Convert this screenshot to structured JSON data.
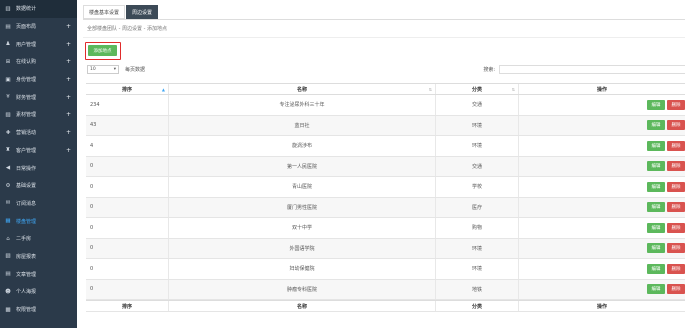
{
  "sidebar": {
    "items": [
      {
        "label": "数据统计",
        "icon": "bar-chart-icon",
        "expandable": false
      },
      {
        "label": "页面布局",
        "icon": "layout-icon",
        "expandable": true
      },
      {
        "label": "用户管理",
        "icon": "user-icon",
        "expandable": true
      },
      {
        "label": "在线认购",
        "icon": "cart-icon",
        "expandable": true
      },
      {
        "label": "身份管理",
        "icon": "id-card-icon",
        "expandable": true
      },
      {
        "label": "财务管理",
        "icon": "money-icon",
        "expandable": true
      },
      {
        "label": "素材管理",
        "icon": "image-icon",
        "expandable": true
      },
      {
        "label": "营销活动",
        "icon": "gift-icon",
        "expandable": true
      },
      {
        "label": "客户管理",
        "icon": "customer-icon",
        "expandable": true
      },
      {
        "label": "日常操作",
        "icon": "megaphone-icon",
        "expandable": false
      },
      {
        "label": "基础设置",
        "icon": "settings-icon",
        "expandable": false
      },
      {
        "label": "订阅消息",
        "icon": "message-icon",
        "expandable": false
      },
      {
        "label": "楼盘管理",
        "icon": "building-icon",
        "expandable": false
      },
      {
        "label": "二手房",
        "icon": "house-icon",
        "expandable": false
      },
      {
        "label": "房屋报表",
        "icon": "report-icon",
        "expandable": false
      },
      {
        "label": "文章管理",
        "icon": "article-icon",
        "expandable": false
      },
      {
        "label": "个人海报",
        "icon": "poster-icon",
        "expandable": false
      },
      {
        "label": "权限管理",
        "icon": "lock-icon",
        "expandable": false
      }
    ]
  },
  "tabs": [
    {
      "label": "楼盘基本设置",
      "active": false
    },
    {
      "label": "周边设置",
      "active": true
    }
  ],
  "breadcrumb": "全部楼盘团队 - 周边设置 - 添加地点",
  "add_button": "添加地点",
  "page_length": {
    "value": "10",
    "label": "每页数据"
  },
  "search": {
    "label": "搜索:",
    "value": ""
  },
  "table": {
    "headers": [
      "排序",
      "名称",
      "分类",
      "操作"
    ],
    "rows": [
      {
        "sort": "234",
        "name": "专注泌尿外科三十年",
        "category": "交通"
      },
      {
        "sort": "43",
        "name": "蓝日社",
        "category": "环境"
      },
      {
        "sort": "4",
        "name": "旋涡涉布",
        "category": "环境"
      },
      {
        "sort": "0",
        "name": "第一人民医院",
        "category": "交通"
      },
      {
        "sort": "0",
        "name": "青山医院",
        "category": "学校"
      },
      {
        "sort": "0",
        "name": "厦门男性医院",
        "category": "医疗"
      },
      {
        "sort": "0",
        "name": "双十中学",
        "category": "购物"
      },
      {
        "sort": "0",
        "name": "外国语学院",
        "category": "环境"
      },
      {
        "sort": "0",
        "name": "妇幼保健院",
        "category": "环境"
      },
      {
        "sort": "0",
        "name": "肿瘤专科医院",
        "category": "地铁"
      }
    ],
    "edit_label": "编辑",
    "delete_label": "删除"
  },
  "colors": {
    "sidebar_bg": "#2b3a4a",
    "accent": "#3fa7f5",
    "edit": "#5cb85c",
    "delete": "#d9534f",
    "highlight_box": "#e02b2b"
  }
}
